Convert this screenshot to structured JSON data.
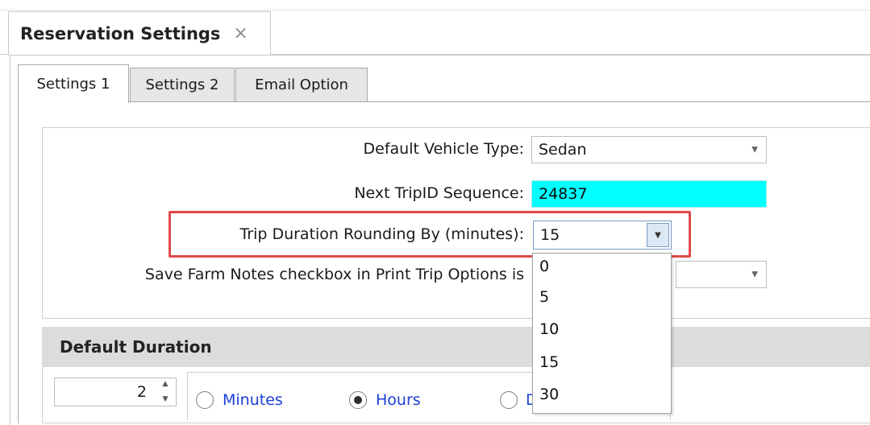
{
  "document_tab": {
    "title": "Reservation Settings",
    "close_glyph": "×"
  },
  "tabs": [
    {
      "label": "Settings 1",
      "active": true
    },
    {
      "label": "Settings 2",
      "active": false
    },
    {
      "label": "Email Option",
      "active": false
    }
  ],
  "settings": {
    "default_vehicle_label": "Default Vehicle Type:",
    "default_vehicle_value": "Sedan",
    "next_tripid_label": "Next TripID Sequence:",
    "next_tripid_value": "24837",
    "rounding_label": "Trip Duration Rounding By (minutes):",
    "rounding_value": "15",
    "farm_notes_label": "Save Farm Notes checkbox in Print Trip Options is"
  },
  "rounding_dropdown": {
    "options": [
      "0",
      "5",
      "10",
      "15",
      "30"
    ]
  },
  "default_duration": {
    "header": "Default Duration",
    "spin_value": "2",
    "radio_options": [
      {
        "label": "Minutes",
        "checked": false
      },
      {
        "label": "Hours",
        "checked": true
      },
      {
        "label": "D",
        "checked": false
      }
    ]
  },
  "colors": {
    "cyan_field": "#00ffff",
    "highlight": "#e04848",
    "radio_label": "#1a3fd6"
  },
  "icons": {
    "close": "close-icon",
    "dropdown": "chevron-down-icon",
    "spinner": "spinner-arrows-icon"
  }
}
